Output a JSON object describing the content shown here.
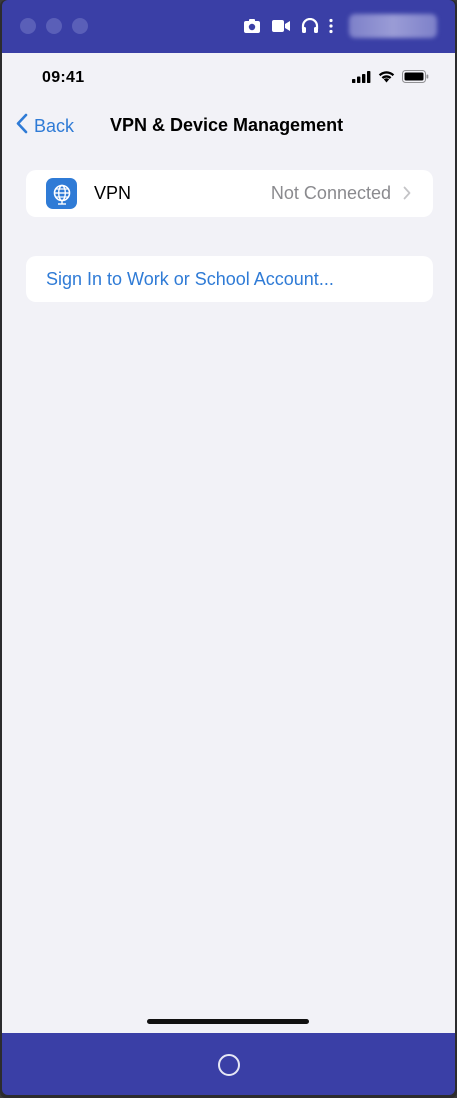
{
  "status_bar": {
    "time": "09:41"
  },
  "nav": {
    "back_label": "Back",
    "title": "VPN & Device Management"
  },
  "vpn_row": {
    "label": "VPN",
    "status": "Not Connected",
    "icon": "globe-vpn-icon"
  },
  "account": {
    "link_label": "Sign In to Work or School Account..."
  },
  "emulator": {
    "toolbar_icons": [
      "camera-icon",
      "video-icon",
      "headphones-icon",
      "more-vertical-icon"
    ],
    "home_button": "home-circle-icon"
  },
  "colors": {
    "emulator_bar": "#3a3fa6",
    "accent_blue": "#2f7bd6",
    "screen_bg": "#f2f2f7"
  }
}
